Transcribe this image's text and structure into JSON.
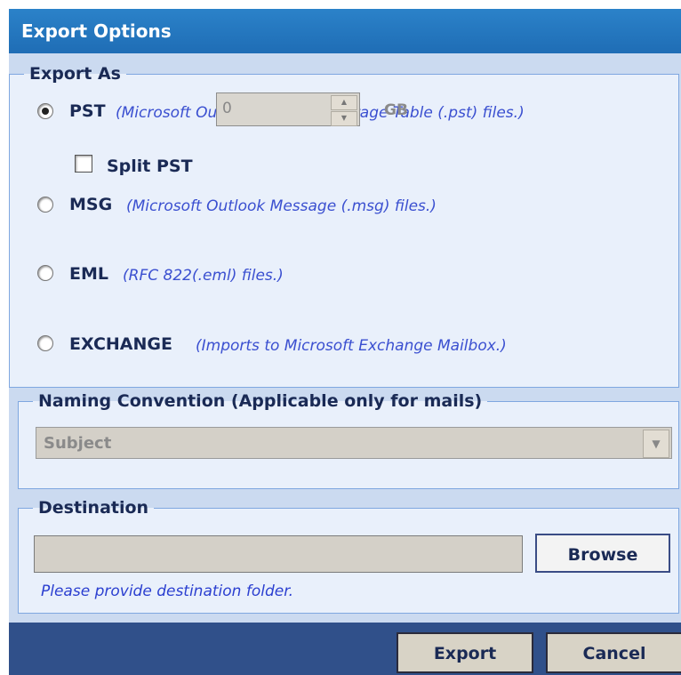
{
  "window": {
    "title": "Export Options"
  },
  "export_as": {
    "legend": "Export As",
    "options": [
      {
        "label": "PST",
        "desc": "(Microsoft Outlook Personal Storage Table (.pst) files.)",
        "selected": true
      },
      {
        "label": "MSG",
        "desc": "(Microsoft Outlook Message (.msg) files.)",
        "selected": false
      },
      {
        "label": "EML",
        "desc": "(RFC 822(.eml) files.)",
        "selected": false
      },
      {
        "label": "EXCHANGE",
        "desc": "(Imports to Microsoft Exchange Mailbox.)",
        "selected": false
      }
    ],
    "split": {
      "label": "Split PST",
      "checked": false,
      "value": "0",
      "unit": "GB"
    }
  },
  "naming": {
    "legend": "Naming Convention (Applicable only for mails)",
    "selected": "Subject"
  },
  "destination": {
    "legend": "Destination",
    "value": "",
    "browse_label": "Browse",
    "hint": "Please provide destination folder."
  },
  "buttons": {
    "export_label": "Export",
    "cancel_label": "Cancel"
  },
  "colors": {
    "title_bar": "#1f6db5",
    "panel": "#cbdaf0",
    "footer": "#30508a",
    "desc_text": "#3a4fd0"
  }
}
